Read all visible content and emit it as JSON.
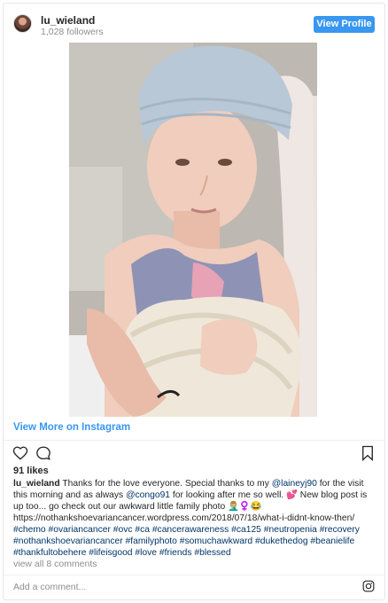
{
  "header": {
    "username": "lu_wieland",
    "followers": "1,028 followers",
    "view_profile_label": "View Profile"
  },
  "post": {
    "view_more_label": "View More on Instagram",
    "likes": "91 likes",
    "caption": {
      "username": "lu_wieland",
      "text_1": " Thanks for the love everyone. Special thanks to my ",
      "mention_1": "@laineyj90",
      "text_2": " for the visit this morning and as always ",
      "mention_2": "@congo91",
      "text_3": " for looking after me so well. 💕 New blog post is up too... go check out our awkward little family photo 🤦🏼‍♂️♀️😂 https://nothankshoevariancancer.wordpress.com/2018/07/18/what-i-didnt-know-then/",
      "hashtags": "#chemo #ovariancancer #ovc #ca #cancerawareness #ca125 #neutropenia #recovery #nothankshoevariancancer #familyphoto #somuchawkward #dukethedog #beanielife #thankfultobehere #lifeisgood #love #friends #blessed"
    },
    "comments_link": "view all 8 comments",
    "add_comment_placeholder": "Add a comment..."
  },
  "icons": {
    "like": "heart-icon",
    "comment": "comment-icon",
    "save": "bookmark-icon",
    "instagram": "instagram-icon"
  },
  "colors": {
    "accent": "#3897f0",
    "text": "#262626",
    "muted": "#8e8e8e",
    "link": "#003569"
  }
}
